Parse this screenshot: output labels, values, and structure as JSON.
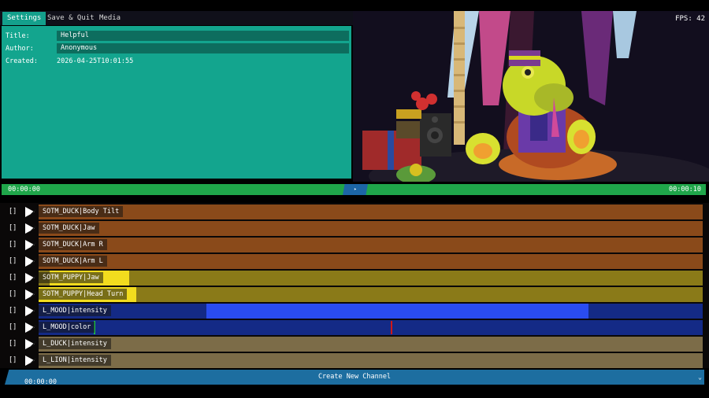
{
  "menu": {
    "settings_label": "Settings",
    "save_quit_label": "Save & Quit",
    "media_label": "Media"
  },
  "settings": {
    "title_label": "Title:",
    "title_value": "Helpful",
    "author_label": "Author:",
    "author_value": "Anonymous",
    "created_label": "Created:",
    "created_value": "2026-04-25T10:01:55"
  },
  "preview": {
    "fps_text": "FPS: 42"
  },
  "timeline": {
    "start_time": "00:00:00",
    "end_time": "00:00:10",
    "playhead_glyph": "▸"
  },
  "channels": [
    {
      "bracket": "[]",
      "label": "SOTM_DUCK|Body Tilt"
    },
    {
      "bracket": "[]",
      "label": "SOTM_DUCK|Jaw"
    },
    {
      "bracket": "[]",
      "label": "SOTM_DUCK|Arm R"
    },
    {
      "bracket": "[]",
      "label": "SOTM_DUCK|Arm L"
    },
    {
      "bracket": "[]",
      "label": "SOTM_PUPPY|Jaw"
    },
    {
      "bracket": "[]",
      "label": "SOTM_PUPPY|Head Turn"
    },
    {
      "bracket": "[]",
      "label": "L_MOOD|intensity"
    },
    {
      "bracket": "[]",
      "label": "L_MOOD|color"
    },
    {
      "bracket": "[]",
      "label": "L_DUCK|intensity"
    },
    {
      "bracket": "[]",
      "label": "L_LION|intensity"
    }
  ],
  "colors": {
    "track_orange": "#8a4a1a",
    "track_olive": "#8a7a18",
    "track_blue": "#142a86",
    "track_khaki": "#7c6c48",
    "highlight_yellow": "#f2dc1e",
    "highlight_blue": "#2a4cf0",
    "marker_green": "#1fb84a",
    "marker_red": "#d01818"
  },
  "bottom": {
    "create_label": "Create New Channel",
    "chevron": "⌄",
    "time": "00:00:00"
  }
}
